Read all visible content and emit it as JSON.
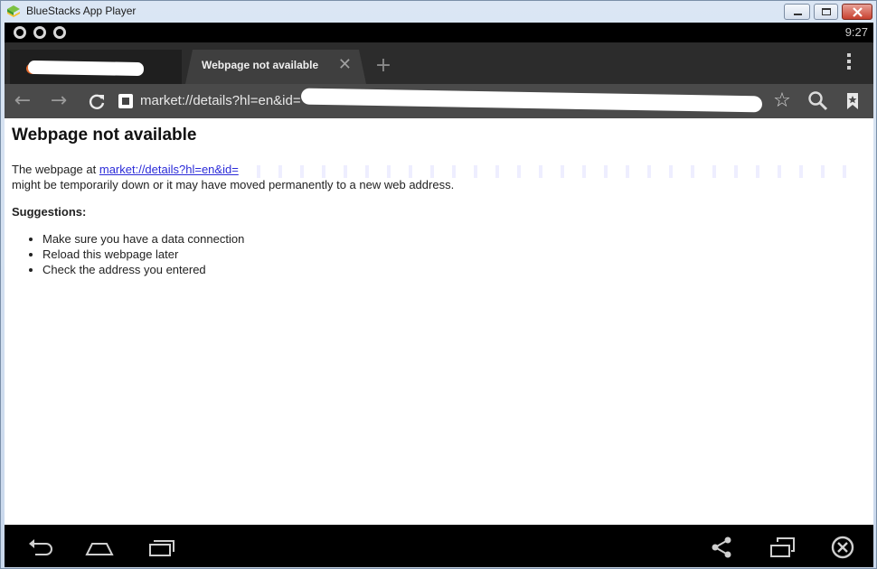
{
  "window": {
    "title": "BlueStacks App Player"
  },
  "status": {
    "time": "9:27"
  },
  "browser": {
    "active_tab_label": "Webpage not available",
    "url_text": "market://details?hl=en&id="
  },
  "page": {
    "heading": "Webpage not available",
    "intro_prefix": "The webpage at",
    "link_text": "market://details?hl=en&id=",
    "intro_suffix": "might be temporarily down or it may have moved permanently to a new web address.",
    "suggestions_heading": "Suggestions:",
    "suggestions": [
      "Make sure you have a data connection",
      "Reload this webpage later",
      "Check the address you entered"
    ]
  },
  "colors": {
    "accent_link": "#2b2bd8",
    "titlebar_bg": "#dbe6f4",
    "close_button": "#c8412f"
  },
  "icons": {
    "back": "back-arrow-icon",
    "forward": "forward-arrow-icon",
    "reload": "reload-icon",
    "bookmark_star": "star-icon",
    "search": "search-icon",
    "bookmarks": "bookmarks-icon",
    "android_back": "android-back-icon",
    "android_home": "android-home-icon",
    "android_recents": "android-recents-icon",
    "share": "share-icon",
    "rotate": "rotate-icon",
    "exit": "close-circle-icon"
  }
}
